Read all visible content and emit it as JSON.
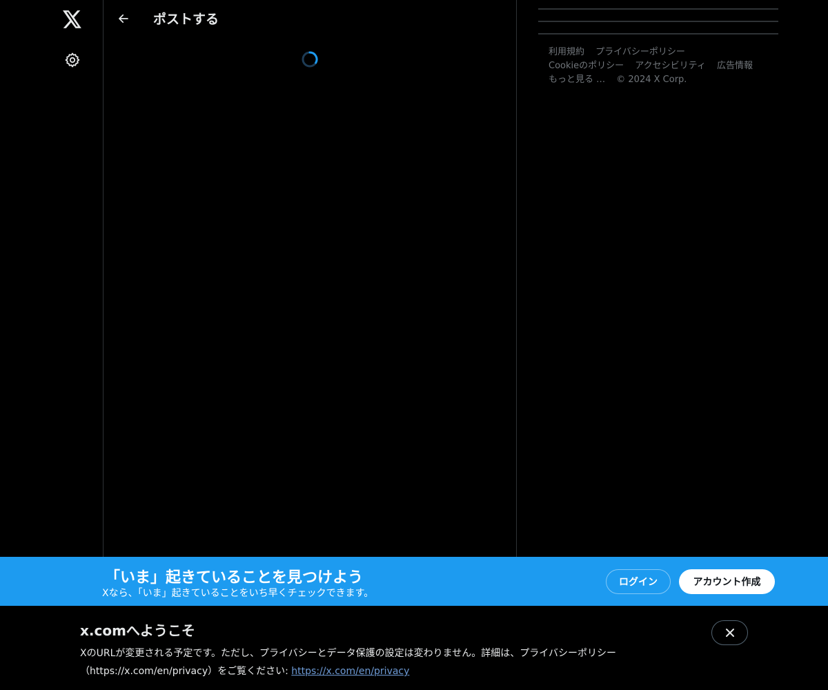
{
  "header": {
    "title": "ポストする",
    "back_icon": "arrow-left-icon"
  },
  "nav": {
    "logo_icon": "x-logo-icon",
    "settings_icon": "gear-icon"
  },
  "main": {
    "loading_icon": "spinner-icon"
  },
  "footer": {
    "links": [
      "利用規約",
      "プライバシーポリシー",
      "Cookieのポリシー",
      "アクセシビリティ",
      "広告情報",
      "もっと見る …"
    ],
    "copyright": "© 2024 X Corp."
  },
  "banner": {
    "title": "「いま」起きていることを見つけよう",
    "subtitle": "Xなら、「いま」起きていることをいち早くチェックできます。",
    "login_label": "ログイン",
    "signup_label": "アカウント作成",
    "background_color": "#1d9bf0"
  },
  "welcome": {
    "title": "x.comへようこそ",
    "text": "XのURLが変更される予定です。ただし、プライバシーとデータ保護の設定は変わりません。詳細は、プライバシーポリシー（https://x.com/en/privacy）をご覧ください: ",
    "link": "https://x.com/en/privacy",
    "close_icon": "close-icon"
  }
}
